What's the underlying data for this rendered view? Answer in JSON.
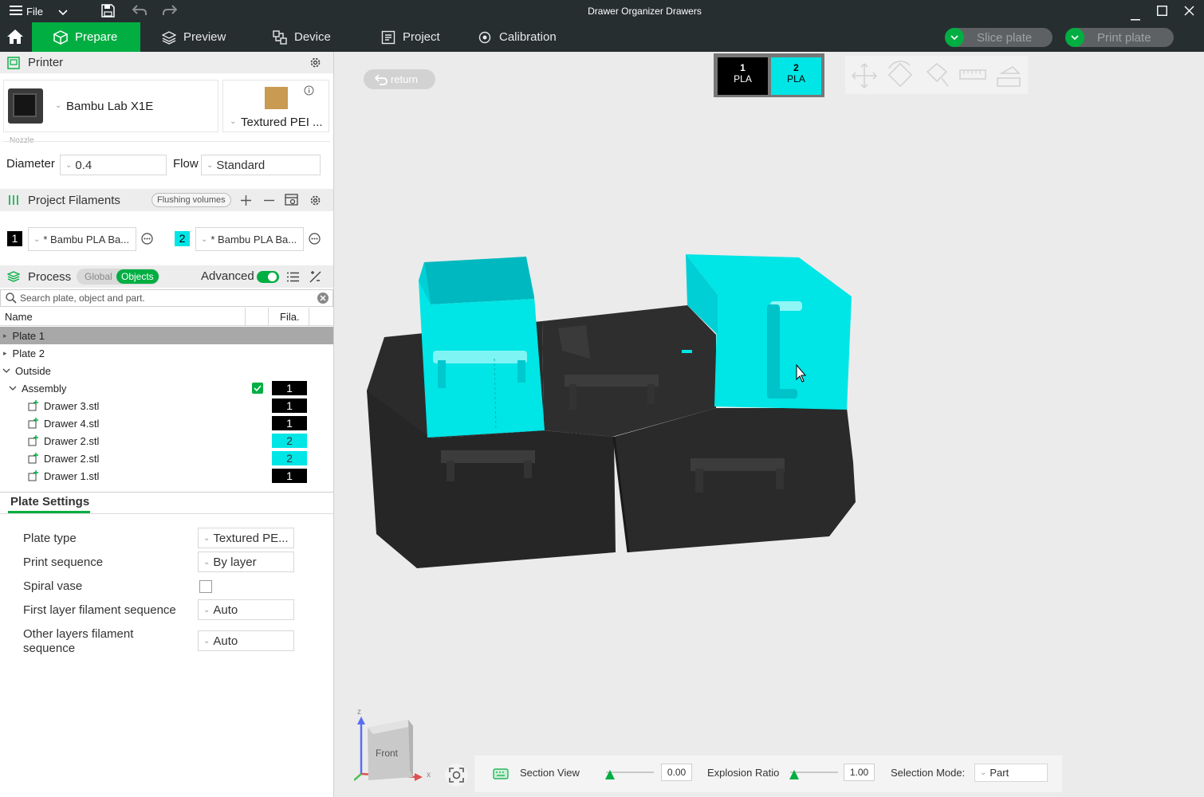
{
  "window": {
    "menu_label": "File",
    "title": "Drawer Organizer Drawers"
  },
  "tabs": [
    {
      "label": "Prepare",
      "icon": "cube-icon"
    },
    {
      "label": "Preview",
      "icon": "layers-icon"
    },
    {
      "label": "Device",
      "icon": "device-icon"
    },
    {
      "label": "Project",
      "icon": "project-icon"
    },
    {
      "label": "Calibration",
      "icon": "calibration-icon"
    }
  ],
  "actions": {
    "slice_label": "Slice plate",
    "print_label": "Print plate"
  },
  "printer": {
    "section_title": "Printer",
    "name": "Bambu Lab X1E",
    "plate": "Textured PEI ...",
    "nozzle_caption": "Nozzle",
    "diameter_label": "Diameter",
    "diameter_value": "0.4",
    "flow_label": "Flow",
    "flow_value": "Standard"
  },
  "filaments": {
    "section_title": "Project Filaments",
    "flushing_label": "Flushing volumes",
    "items": [
      {
        "num": "1",
        "name": "* Bambu PLA Ba...",
        "color": "#000000"
      },
      {
        "num": "2",
        "name": "* Bambu PLA Ba...",
        "color": "#00e5e5"
      }
    ]
  },
  "process": {
    "section_title": "Process",
    "global_label": "Global",
    "objects_label": "Objects",
    "advanced_label": "Advanced",
    "search_placeholder": "Search plate, object and part."
  },
  "object_list": {
    "col_name": "Name",
    "col_fila": "Fila.",
    "rows": [
      {
        "label": "Plate 1",
        "indent": 0,
        "expander": "right",
        "selected": true
      },
      {
        "label": "Plate 2",
        "indent": 0,
        "expander": "right"
      },
      {
        "label": "Outside",
        "indent": 0,
        "expander": "down"
      },
      {
        "label": "Assembly",
        "indent": 1,
        "expander": "down",
        "checked": true,
        "fila": "1",
        "fila_color": "#000000"
      },
      {
        "label": "Drawer 3.stl",
        "indent": 2,
        "part": true,
        "fila": "1",
        "fila_color": "#000000"
      },
      {
        "label": "Drawer 4.stl",
        "indent": 2,
        "part": true,
        "fila": "1",
        "fila_color": "#000000"
      },
      {
        "label": "Drawer 2.stl",
        "indent": 2,
        "part": true,
        "fila": "2",
        "fila_color": "#00e5e5"
      },
      {
        "label": "Drawer 2.stl",
        "indent": 2,
        "part": true,
        "fila": "2",
        "fila_color": "#00e5e5"
      },
      {
        "label": "Drawer 1.stl",
        "indent": 2,
        "part": true,
        "fila": "1",
        "fila_color": "#000000"
      }
    ]
  },
  "plate_settings": {
    "title": "Plate Settings",
    "plate_type_label": "Plate type",
    "plate_type_value": "Textured PE...",
    "print_sequence_label": "Print sequence",
    "print_sequence_value": "By layer",
    "spiral_label": "Spiral vase",
    "first_layer_label": "First layer filament sequence",
    "first_layer_value": "Auto",
    "other_layers_label_1": "Other layers filament",
    "other_layers_label_2": "sequence",
    "other_layers_value": "Auto"
  },
  "viewport": {
    "return_label": "return",
    "swatches": [
      {
        "num": "1",
        "type": "PLA",
        "color": "#000000",
        "text_color": "#ffffff"
      },
      {
        "num": "2",
        "type": "PLA",
        "color": "#00e5e5",
        "text_color": "#000000"
      }
    ],
    "cube_face_label": "Front",
    "axis_z": "z",
    "axis_x": "x"
  },
  "bottom_bar": {
    "section_view_label": "Section View",
    "section_value": "0.00",
    "explosion_label": "Explosion Ratio",
    "explosion_value": "1.00",
    "selection_mode_label": "Selection Mode:",
    "selection_mode_value": "Part"
  },
  "colors": {
    "accent": "#00ae42",
    "dark_bar": "#262e30",
    "cyan_filament": "#00e5e5",
    "black_filament": "#000000"
  }
}
